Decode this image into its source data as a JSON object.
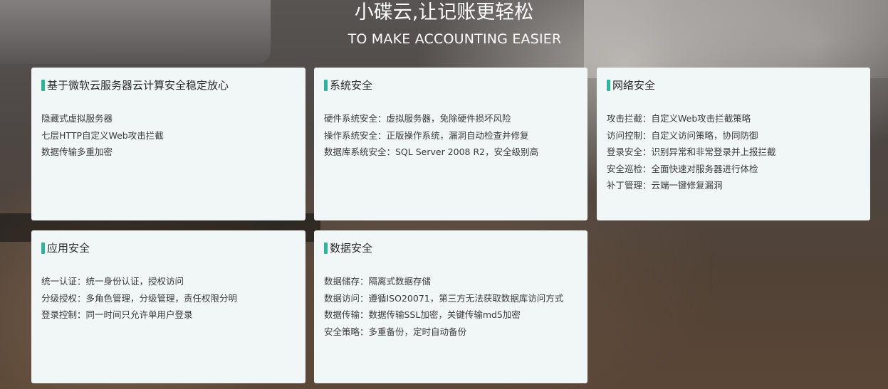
{
  "hero": {
    "title": "小碟云,让记账更轻松",
    "subtitle": "TO MAKE ACCOUNTING EASIER"
  },
  "colors": {
    "accent": "#2fb39b",
    "card_background": "#f1f6f7"
  },
  "cards": [
    {
      "title": "基于微软云服务器云计算安全稳定放心",
      "items": [
        "隐藏式虚拟服务器",
        "七层HTTP自定义Web攻击拦截",
        "数据传输多重加密"
      ]
    },
    {
      "title": "系统安全",
      "items": [
        "硬件系统安全：虚拟服务器，免除硬件损坏风险",
        "操作系统安全：正版操作系统，漏洞自动检查并修复",
        "数据库系统安全：SQL Server 2008 R2，安全级别高"
      ]
    },
    {
      "title": "网络安全",
      "items": [
        "攻击拦截：自定义Web攻击拦截策略",
        "访问控制：自定义访问策略，协同防御",
        "登录安全：识别异常和非常登录并上报拦截",
        "安全巡检：全面快速对服务器进行体检",
        "补丁管理：云端一键修复漏洞"
      ]
    },
    {
      "title": "应用安全",
      "items": [
        "统一认证：统一身份认证，授权访问",
        "分级授权：多角色管理，分级管理，责任权限分明",
        "登录控制：同一时间只允许单用户登录"
      ]
    },
    {
      "title": "数据安全",
      "items": [
        "数据储存：隔离式数据存储",
        "数据访问：遵循ISO20071，第三方无法获取数据库访问方式",
        "数据传输：数据传输SSL加密，关键传输md5加密",
        "安全策略：多重备份，定时自动备份"
      ]
    }
  ]
}
